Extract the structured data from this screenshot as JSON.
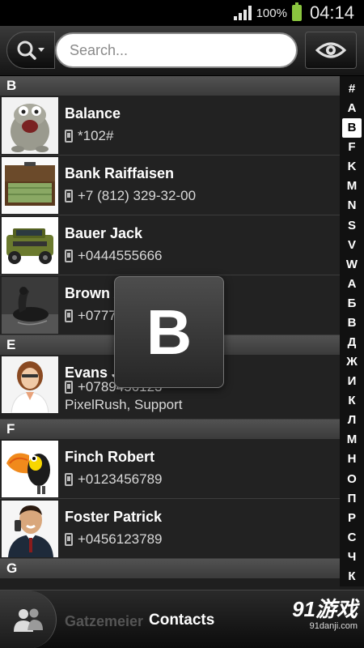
{
  "status_bar": {
    "battery": "100%",
    "time": "04:14"
  },
  "search": {
    "placeholder": "Search..."
  },
  "sections": [
    {
      "letter": "B",
      "contacts": [
        {
          "name": "Balance",
          "phone": "*102#",
          "avatar": "monster"
        },
        {
          "name": "Bank Raiffaisen",
          "phone": "+7 (812) 329-32-00",
          "avatar": "money-case"
        },
        {
          "name": "Bauer Jack",
          "phone": "+0444555666",
          "avatar": "hummer"
        },
        {
          "name": "Brown Alexander",
          "phone": "+07778889",
          "avatar": "duck"
        }
      ]
    },
    {
      "letter": "E",
      "contacts": [
        {
          "name": "Evans Julia",
          "phone": "+0789456123",
          "company": "PixelRush, Support",
          "avatar": "woman"
        }
      ]
    },
    {
      "letter": "F",
      "contacts": [
        {
          "name": "Finch Robert",
          "phone": "+0123456789",
          "avatar": "toucan"
        },
        {
          "name": "Foster Patrick",
          "phone": "+0456123789",
          "avatar": "man"
        }
      ]
    },
    {
      "letter": "G",
      "contacts": [
        {
          "name": "Gatzemeier",
          "avatar": ""
        }
      ]
    }
  ],
  "alphabet": [
    "#",
    "A",
    "B",
    "F",
    "K",
    "M",
    "N",
    "S",
    "V",
    "W",
    "А",
    "Б",
    "В",
    "Д",
    "Ж",
    "И",
    "К",
    "Л",
    "М",
    "Н",
    "О",
    "П",
    "Р",
    "С",
    "Ч",
    "К"
  ],
  "active_letter": "B",
  "popup_letter": "B",
  "bottom_bar": {
    "title": "Contacts",
    "watermark": "91游戏",
    "watermark_sub": "91danji.com"
  }
}
